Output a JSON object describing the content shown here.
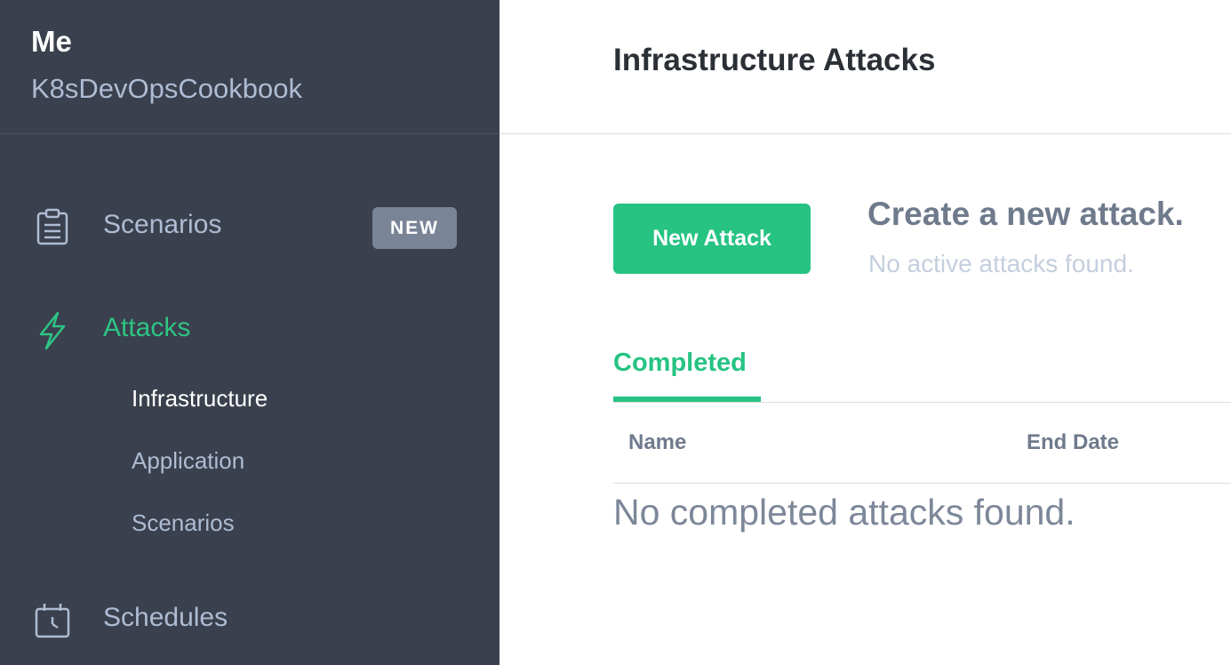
{
  "sidebar": {
    "account_name": "Me",
    "team_name": "K8sDevOpsCookbook",
    "nav": {
      "scenarios": {
        "label": "Scenarios",
        "badge": "NEW",
        "icon": "clipboard-icon"
      },
      "attacks": {
        "label": "Attacks",
        "icon": "lightning-icon",
        "active": true
      },
      "schedules": {
        "label": "Schedules",
        "icon": "calendar-clock-icon"
      }
    },
    "attack_subnav": [
      {
        "label": "Infrastructure",
        "current": true
      },
      {
        "label": "Application"
      },
      {
        "label": "Scenarios"
      }
    ]
  },
  "header": {
    "title": "Infrastructure Attacks"
  },
  "main": {
    "new_attack_button": "New Attack",
    "create_title": "Create a new attack.",
    "create_subtitle": "No active attacks found.",
    "tab_completed": "Completed",
    "columns": [
      "Name",
      "End Date"
    ],
    "empty_message": "No completed attacks found."
  },
  "colors": {
    "sidebar_bg": "#3a404d",
    "accent_green": "#26c383",
    "muted_text": "#aebcd4",
    "badge_bg": "#7a8497"
  }
}
